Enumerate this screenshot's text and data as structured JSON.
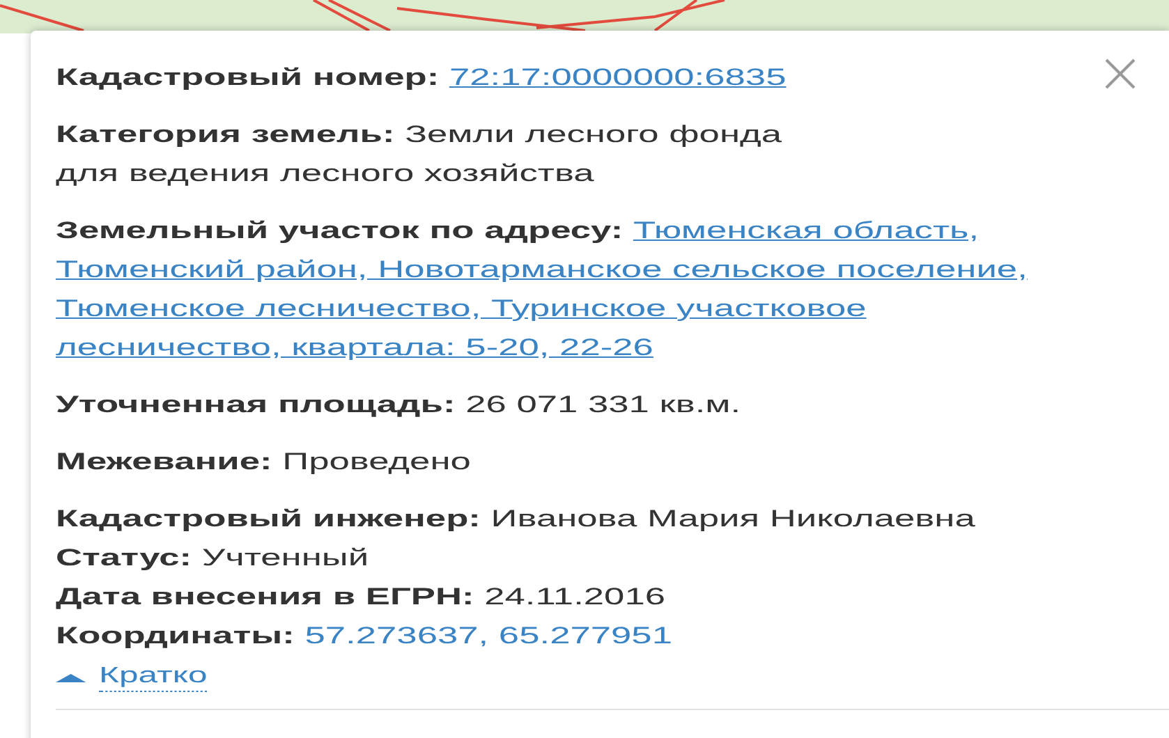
{
  "sections": [
    {
      "fields": [
        {
          "label": "Кадастровый номер:",
          "value": "72:17:0000000:6835",
          "kind": "link"
        }
      ]
    },
    {
      "fields": [
        {
          "label": "Категория земель:",
          "value": "Земли лесного фонда\nдля ведения лесного хозяйства",
          "kind": "text"
        }
      ]
    },
    {
      "fields": [
        {
          "label": "Земельный участок по адресу:",
          "value": "Тюменская область,\nТюменский район, Новотарманское сельское поселение,\nТюменское лесничество, Туринское участковое\nлесничество, квартала: 5-20, 22-26",
          "kind": "link"
        }
      ]
    },
    {
      "fields": [
        {
          "label": "Уточненная площадь:",
          "value": "26 071 331 кв.м.",
          "kind": "text"
        }
      ]
    },
    {
      "fields": [
        {
          "label": "Межевание:",
          "value": "Проведено",
          "kind": "text"
        }
      ]
    },
    {
      "fields": [
        {
          "label": "Кадастровый инженер:",
          "value": "Иванова Мария Николаевна",
          "kind": "text"
        },
        {
          "label": "Статус:",
          "value": "Учтенный",
          "kind": "text"
        },
        {
          "label": "Дата внесения в ЕГРН:",
          "value": "24.11.2016",
          "kind": "text"
        },
        {
          "label": "Координаты:",
          "value": "57.273637, 65.277951",
          "kind": "coords"
        }
      ]
    }
  ],
  "toggle": {
    "label": "Кратко",
    "expanded": true
  }
}
